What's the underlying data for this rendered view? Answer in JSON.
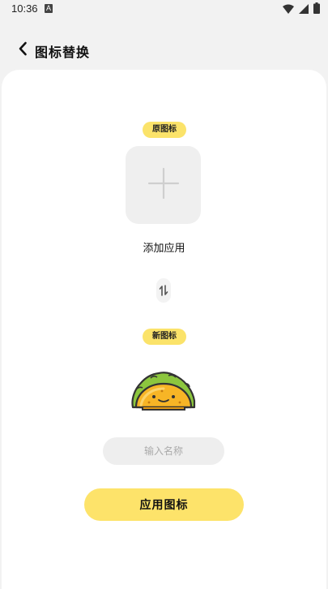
{
  "status_bar": {
    "time": "10:36",
    "notification_badge": "A",
    "icons": [
      "wifi-icon",
      "signal-icon",
      "battery-icon"
    ]
  },
  "header": {
    "back_icon": "chevron-left-icon",
    "title": "图标替换"
  },
  "original": {
    "tag": "原图标",
    "add_icon": "plus-icon",
    "add_label": "添加应用"
  },
  "swap_icon": "swap-arrows-icon",
  "new_icon": {
    "tag": "新图标",
    "icon": "taco-icon"
  },
  "name_input": {
    "value": "",
    "placeholder": "输入名称"
  },
  "apply_button": {
    "label": "应用图标"
  },
  "colors": {
    "accent_yellow": "#fde36a",
    "background": "#f2f2f2",
    "card": "#ffffff",
    "input_bg": "#eeeeee"
  }
}
